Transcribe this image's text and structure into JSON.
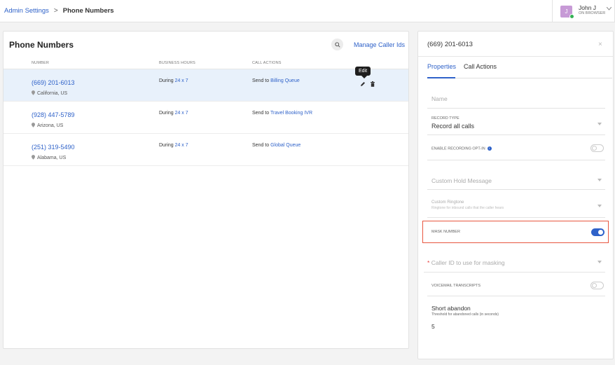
{
  "breadcrumb": {
    "root": "Admin Settings",
    "separator": ">",
    "current": "Phone Numbers"
  },
  "user": {
    "initial": "J",
    "name": "John J",
    "status": "ON BROWSER"
  },
  "list": {
    "title": "Phone Numbers",
    "search_icon": "search-icon",
    "manage_link": "Manage Caller Ids",
    "columns": [
      "NUMBER",
      "BUSINESS HOURS",
      "CALL ACTIONS"
    ],
    "rows": [
      {
        "number": "(669) 201-6013",
        "location": "California, US",
        "hours_prefix": "During",
        "hours_link": "24 x 7",
        "action_prefix": "Send to",
        "action_link": "Billing Queue"
      },
      {
        "number": "(928) 447-5789",
        "location": "Arizona, US",
        "hours_prefix": "During",
        "hours_link": "24 x 7",
        "action_prefix": "Send to",
        "action_link": "Travel Booking IVR"
      },
      {
        "number": "(251) 319-5490",
        "location": "Alabama, US",
        "hours_prefix": "During",
        "hours_link": "24 x 7",
        "action_prefix": "Send to",
        "action_link": "Global Queue"
      }
    ],
    "tooltip": "Edit"
  },
  "detail": {
    "title": "(669) 201-6013",
    "close_glyph": "×",
    "tabs": [
      "Properties",
      "Call Actions"
    ],
    "name_placeholder": "Name",
    "record_type_label": "RECORD TYPE",
    "record_type_value": "Record all calls",
    "recording_optin_label": "ENABLE RECORDING OPT-IN",
    "info_glyph": "i",
    "custom_hold_placeholder": "Custom Hold Message",
    "custom_ringtone_placeholder": "Custom Ringtone",
    "custom_ringtone_help": "Ringtone for inbound calls that the caller hears",
    "mask_number_label": "MASK NUMBER",
    "mask_number_on": true,
    "required_mark": "*",
    "caller_id_placeholder": "Caller ID to use for masking",
    "voicemail_label": "VOICEMAIL TRANSCRIPTS",
    "short_abandon_title": "Short abandon",
    "short_abandon_help": "Threshold for abandoned calls (in seconds)",
    "short_abandon_value": "5"
  },
  "colors": {
    "accent": "#2f62c9",
    "highlight_row": "#e8f1fb",
    "mask_border": "#e8563f",
    "online": "#35b155"
  }
}
